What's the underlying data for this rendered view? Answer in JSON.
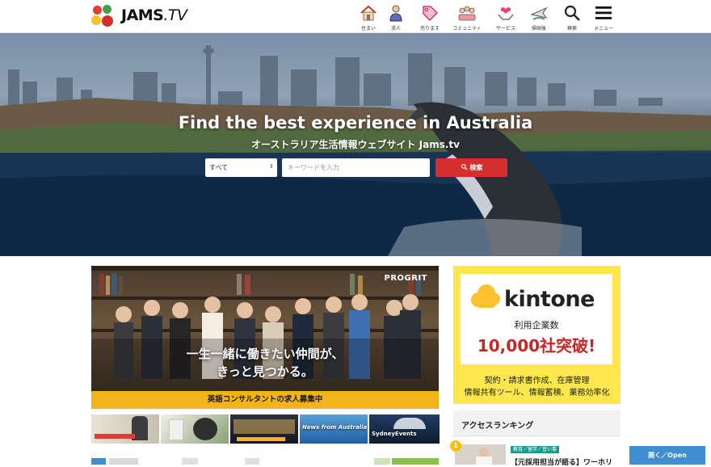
{
  "header": {
    "logo_text": "JAMS",
    "logo_suffix": ".TV",
    "nav": [
      {
        "label": "住まい",
        "icon": "house-icon"
      },
      {
        "label": "求人",
        "icon": "worker-icon"
      },
      {
        "label": "売ります",
        "icon": "price-tag-icon"
      },
      {
        "label": "コミュニティ",
        "icon": "community-icon"
      },
      {
        "label": "サービス",
        "icon": "heart-hands-icon"
      },
      {
        "label": "帰国後",
        "icon": "plane-return-icon"
      },
      {
        "label": "検索",
        "icon": "search-icon"
      },
      {
        "label": "メニュー",
        "icon": "hamburger-menu-icon"
      }
    ]
  },
  "hero": {
    "title": "Find the best experience in Australia",
    "subtitle": "オーストラリア生活情報ウェブサイト Jams.tv",
    "category_selected": "すべて",
    "keyword_placeholder": "キーワードを入力",
    "search_button": "検索"
  },
  "banner": {
    "brand": "PROGRIT",
    "headline_line1": "一生一緒に働きたい仲間が、",
    "headline_line2": "きっと見つかる。",
    "strip_text": "英語コンサルタントの求人募集中"
  },
  "thumbnails": [
    {
      "text": ""
    },
    {
      "text": ""
    },
    {
      "text": ""
    },
    {
      "text": "News from Australia"
    },
    {
      "text": "SydneyEvents"
    }
  ],
  "ad": {
    "brand": "kintone",
    "count_label": "利用企業数",
    "count": "10,000社突破!",
    "line1": "契約・請求書作成、在庫管理",
    "line2": "情報共有ツール、情報蓄積、業務効率化"
  },
  "ranking": {
    "title": "アクセスランキング",
    "items": [
      {
        "rank": "1",
        "tag": "教育／留学／習い事",
        "headline": "【元採用担当が語る】ワーホリ"
      }
    ]
  },
  "open_button": "開く／Open",
  "colors": {
    "accent_red": "#d32f2f",
    "strip_yellow": "#f2b418",
    "ad_yellow": "#fde74c",
    "open_blue": "#3d8fd1",
    "tag_teal": "#1a9c8c"
  }
}
